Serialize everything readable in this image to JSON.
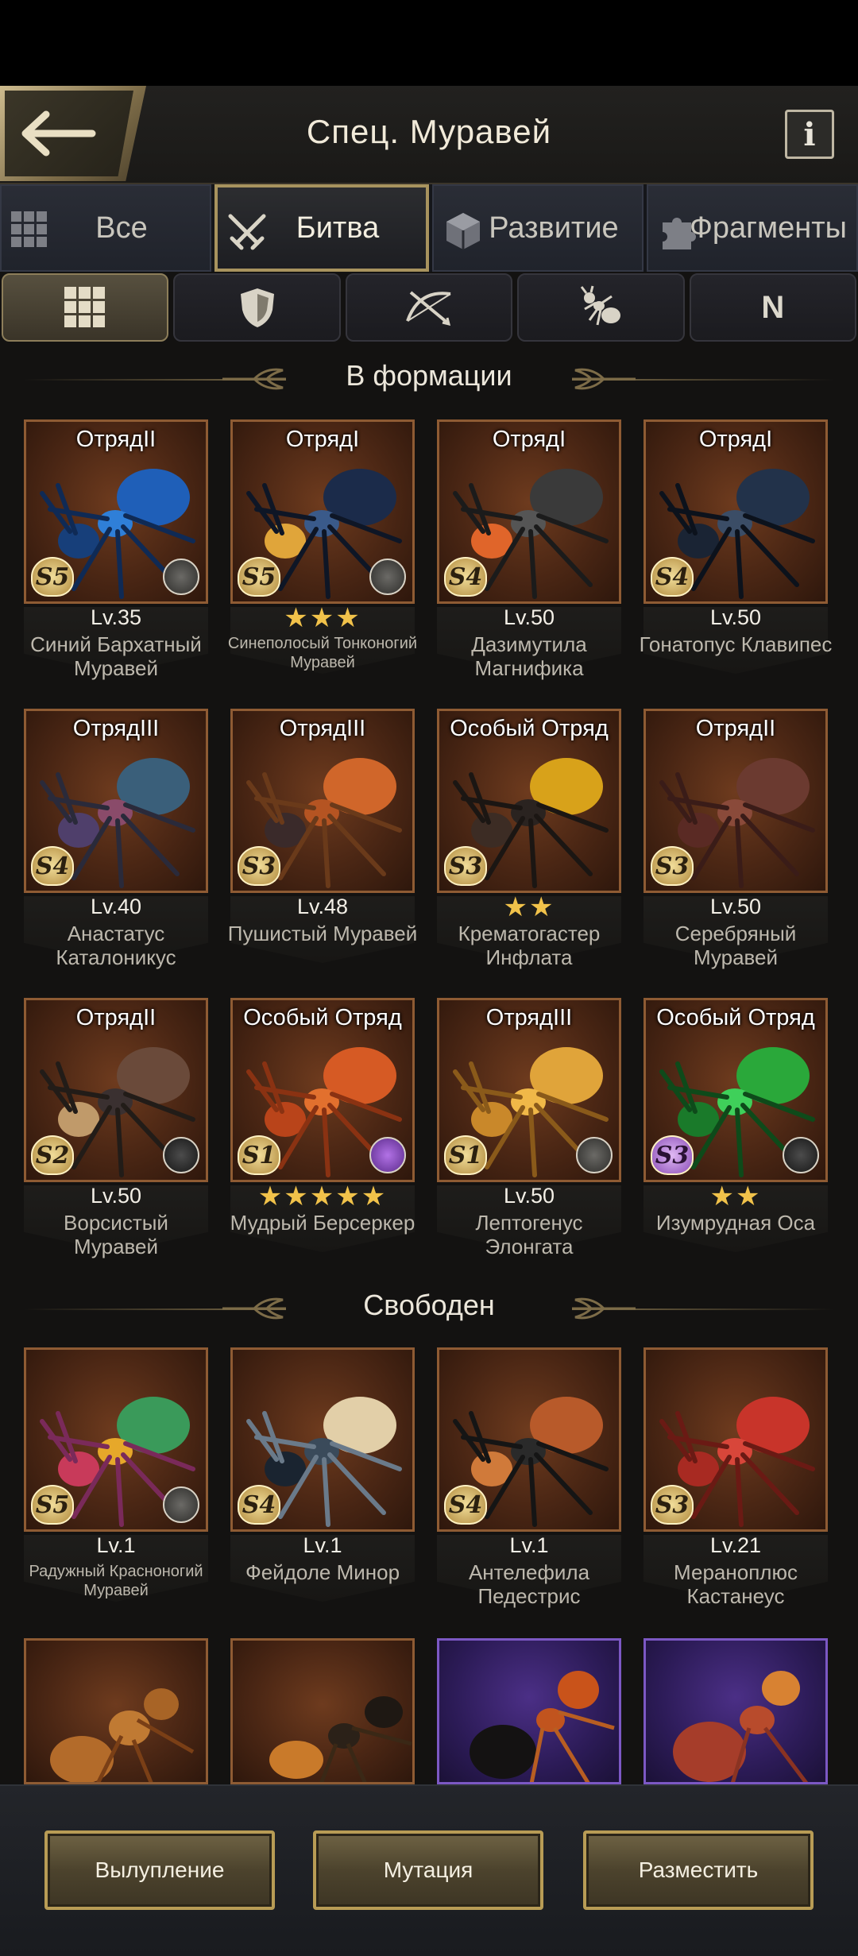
{
  "header": {
    "title": "Спец. Муравей",
    "info_label": "i"
  },
  "tabs": [
    {
      "label": "Все",
      "icon": "grid-icon",
      "active": false
    },
    {
      "label": "Битва",
      "icon": "crossed-swords-icon",
      "active": true
    },
    {
      "label": "Развитие",
      "icon": "cube-icon",
      "active": false
    },
    {
      "label": "Фрагменты",
      "icon": "puzzle-icon",
      "active": false
    }
  ],
  "filters": [
    {
      "name": "all",
      "icon": "grid-icon",
      "active": true
    },
    {
      "name": "defense",
      "icon": "shield-icon",
      "active": false
    },
    {
      "name": "ranged",
      "icon": "bow-icon",
      "active": false
    },
    {
      "name": "ant",
      "icon": "ant-icon",
      "active": false
    },
    {
      "name": "n",
      "label": "N",
      "active": false
    }
  ],
  "sections": {
    "in_formation": "В формации",
    "free": "Свободен"
  },
  "formation_cards": [
    {
      "squad": "ОтрядII",
      "grade": "S5",
      "level": "Lv.35",
      "name": "Синий Бархатный Муравей",
      "emblem": "grey"
    },
    {
      "squad": "ОтрядI",
      "grade": "S5",
      "stars": "★★★",
      "name": "Синеполосый Тонконогий Муравей",
      "small": true,
      "emblem": "grey"
    },
    {
      "squad": "ОтрядI",
      "grade": "S4",
      "level": "Lv.50",
      "name": "Дазимутила Магнифика"
    },
    {
      "squad": "ОтрядI",
      "grade": "S4",
      "level": "Lv.50",
      "name": "Гонатопус Клавипес"
    },
    {
      "squad": "ОтрядIII",
      "grade": "S4",
      "level": "Lv.40",
      "name": "Анастатус Каталоникус"
    },
    {
      "squad": "ОтрядIII",
      "grade": "S3",
      "level": "Lv.48",
      "name": "Пушистый Муравей"
    },
    {
      "squad": "Особый Отряд",
      "grade": "S3",
      "stars": "★★",
      "name": "Крематогастер Инфлата"
    },
    {
      "squad": "ОтрядII",
      "grade": "S3",
      "level": "Lv.50",
      "name": "Серебряный Муравей"
    },
    {
      "squad": "ОтрядII",
      "grade": "S2",
      "level": "Lv.50",
      "name": "Ворсистый Муравей",
      "emblem": "dark"
    },
    {
      "squad": "Особый Отряд",
      "grade": "S1",
      "stars": "★★★★★",
      "name": "Мудрый Берсеркер",
      "emblem": "purple"
    },
    {
      "squad": "ОтрядIII",
      "grade": "S1",
      "level": "Lv.50",
      "name": "Лептогенус Элонгата",
      "emblem": "grey"
    },
    {
      "squad": "Особый Отряд",
      "grade": "S3",
      "stars": "★★",
      "name": "Изумрудная Оса",
      "emblem": "dark",
      "violet": true
    }
  ],
  "free_cards": [
    {
      "grade": "S5",
      "level": "Lv.1",
      "name": "Радужный Красноногий Муравей",
      "small": true,
      "emblem": "grey"
    },
    {
      "grade": "S4",
      "level": "Lv.1",
      "name": "Фейдоле Минор"
    },
    {
      "grade": "S4",
      "level": "Lv.1",
      "name": "Антелефила Педестрис"
    },
    {
      "grade": "S3",
      "level": "Lv.21",
      "name": "Мераноплюс Кастанеус"
    }
  ],
  "buttons": {
    "hatch": "Вылупление",
    "mutation": "Мутация",
    "deploy": "Разместить"
  },
  "colors": {
    "accent_gold": "#b89c55",
    "star": "#f1c24a",
    "portrait_frame": "#8e5b33",
    "purple_frame": "#7c58c4"
  }
}
